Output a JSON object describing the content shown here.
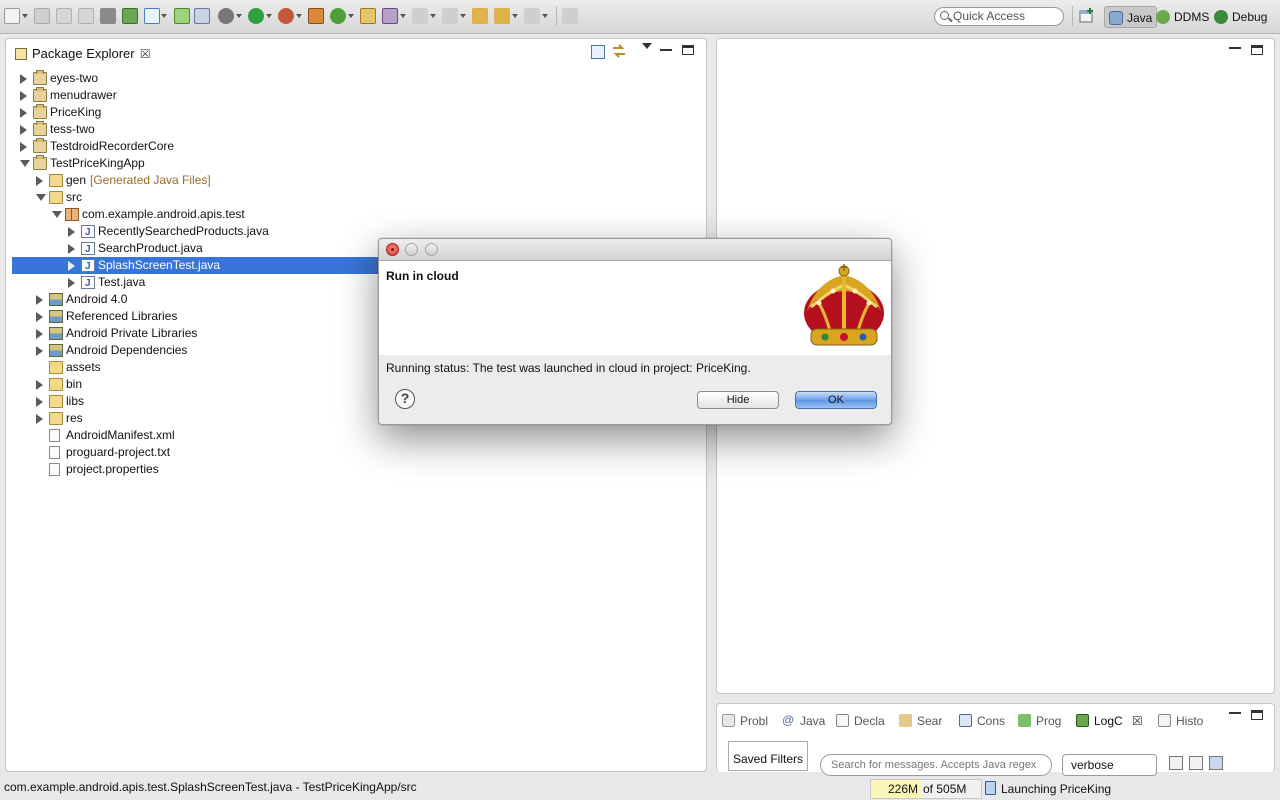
{
  "toolbar": {
    "quick_access_placeholder": "Quick Access",
    "perspectives": [
      {
        "label": "Java",
        "active": true
      },
      {
        "label": "DDMS",
        "active": false
      },
      {
        "label": "Debug",
        "active": false
      }
    ]
  },
  "package_explorer": {
    "title": "Package Explorer",
    "tree": [
      {
        "label": "eyes-two",
        "level": 0,
        "expanded": false,
        "icon": "project-icon"
      },
      {
        "label": "menudrawer",
        "level": 0,
        "expanded": false,
        "icon": "project-icon"
      },
      {
        "label": "PriceKing",
        "level": 0,
        "expanded": false,
        "icon": "project-icon"
      },
      {
        "label": "tess-two",
        "level": 0,
        "expanded": false,
        "icon": "project-icon"
      },
      {
        "label": "TestdroidRecorderCore",
        "level": 0,
        "expanded": false,
        "icon": "project-icon"
      },
      {
        "label": "TestPriceKingApp",
        "level": 0,
        "expanded": true,
        "icon": "project-icon"
      },
      {
        "label": "gen",
        "decoration": "[Generated Java Files]",
        "level": 1,
        "expanded": false,
        "icon": "source-folder-icon"
      },
      {
        "label": "src",
        "level": 1,
        "expanded": true,
        "icon": "source-folder-icon"
      },
      {
        "label": "com.example.android.apis.test",
        "level": 2,
        "expanded": true,
        "icon": "package-icon"
      },
      {
        "label": "RecentlySearchedProducts.java",
        "level": 3,
        "expanded": false,
        "icon": "java-file-icon"
      },
      {
        "label": "SearchProduct.java",
        "level": 3,
        "expanded": false,
        "icon": "java-file-icon"
      },
      {
        "label": "SplashScreenTest.java",
        "level": 3,
        "expanded": false,
        "icon": "java-file-icon",
        "selected": true
      },
      {
        "label": "Test.java",
        "level": 3,
        "expanded": false,
        "icon": "java-file-icon"
      },
      {
        "label": "Android 4.0",
        "level": 1,
        "expanded": false,
        "icon": "library-icon"
      },
      {
        "label": "Referenced Libraries",
        "level": 1,
        "expanded": false,
        "icon": "library-icon"
      },
      {
        "label": "Android Private Libraries",
        "level": 1,
        "expanded": false,
        "icon": "library-icon"
      },
      {
        "label": "Android Dependencies",
        "level": 1,
        "expanded": false,
        "icon": "library-icon"
      },
      {
        "label": "assets",
        "level": 1,
        "leaf": true,
        "icon": "folder-icon"
      },
      {
        "label": "bin",
        "level": 1,
        "expanded": false,
        "icon": "folder-icon"
      },
      {
        "label": "libs",
        "level": 1,
        "expanded": false,
        "icon": "folder-icon"
      },
      {
        "label": "res",
        "level": 1,
        "expanded": false,
        "icon": "folder-icon"
      },
      {
        "label": "AndroidManifest.xml",
        "level": 1,
        "leaf": true,
        "icon": "xml-file-icon"
      },
      {
        "label": "proguard-project.txt",
        "level": 1,
        "leaf": true,
        "icon": "text-file-icon"
      },
      {
        "label": "project.properties",
        "level": 1,
        "leaf": true,
        "icon": "text-file-icon"
      }
    ]
  },
  "bottom_panel": {
    "tabs": [
      {
        "label": "Probl",
        "icon": "problems-icon"
      },
      {
        "label": "Java",
        "icon": "javadoc-icon"
      },
      {
        "label": "Decla",
        "icon": "declaration-icon"
      },
      {
        "label": "Sear",
        "icon": "search-icon"
      },
      {
        "label": "Cons",
        "icon": "console-icon"
      },
      {
        "label": "Prog",
        "icon": "progress-icon"
      },
      {
        "label": "LogC",
        "icon": "logcat-icon",
        "active": true
      },
      {
        "label": "Histo",
        "icon": "history-icon"
      }
    ],
    "saved_filters_label": "Saved Filters",
    "log_search_placeholder": "Search for messages. Accepts Java regex",
    "log_level": "verbose"
  },
  "status_bar": {
    "selection_path": "com.example.android.apis.test.SplashScreenTest.java - TestPriceKingApp/src",
    "heap_used": "226M",
    "heap_total": "of 505M",
    "heap_fraction": 0.45,
    "background_task": "Launching PriceKing"
  },
  "dialog": {
    "heading": "Run in cloud",
    "message": "Running status: The test was launched in cloud in project: PriceKing.",
    "help_label": "?",
    "hide_label": "Hide",
    "ok_label": "OK",
    "logo": "crown-logo"
  },
  "colors": {
    "selection": "#3875d7",
    "ok_button": "#6ea1e8",
    "heap_fill": "#fbf5b8",
    "crown_red": "#c8102e",
    "crown_gold": "#d9a520"
  }
}
